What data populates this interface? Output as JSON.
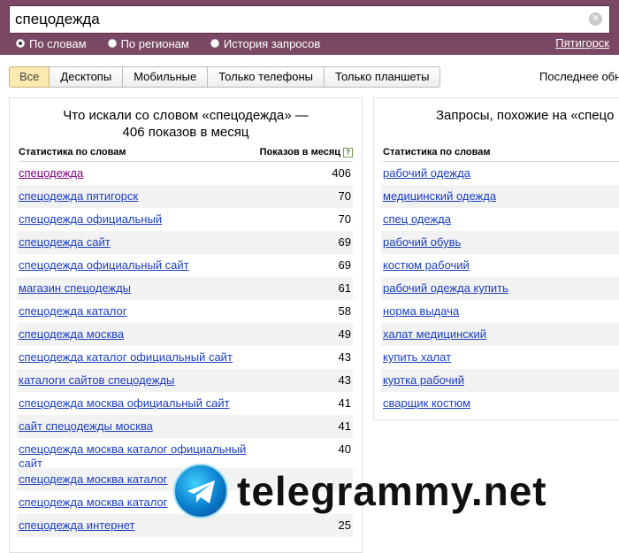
{
  "search": {
    "query": "спецодежда"
  },
  "modes": [
    {
      "label": "По словам",
      "selected": true
    },
    {
      "label": "По регионам",
      "selected": false
    },
    {
      "label": "История запросов",
      "selected": false
    }
  ],
  "region": "Пятигорск",
  "tabs": [
    "Все",
    "Десктопы",
    "Мобильные",
    "Только телефоны",
    "Только планшеты"
  ],
  "active_tab": "Все",
  "last_updated": "Последнее обн",
  "left_panel": {
    "title": "Что искали со словом «спецодежда» — 406 показов в месяц",
    "col_words": "Статистика по словам",
    "col_shows": "Показов в месяц",
    "help_icon": "?",
    "rows": [
      {
        "phrase": "спецодежда",
        "count": "406"
      },
      {
        "phrase": "спецодежда пятигорск",
        "count": "70"
      },
      {
        "phrase": "спецодежда официальный",
        "count": "70"
      },
      {
        "phrase": "спецодежда сайт",
        "count": "69"
      },
      {
        "phrase": "спецодежда официальный сайт",
        "count": "69"
      },
      {
        "phrase": "магазин спецодежды",
        "count": "61"
      },
      {
        "phrase": "спецодежда каталог",
        "count": "58"
      },
      {
        "phrase": "спецодежда москва",
        "count": "49"
      },
      {
        "phrase": "спецодежда каталог официальный сайт",
        "count": "43"
      },
      {
        "phrase": "каталоги сайтов спецодежды",
        "count": "43"
      },
      {
        "phrase": "спецодежда москва официальный сайт",
        "count": "41"
      },
      {
        "phrase": "сайт спецодежды москва",
        "count": "41"
      },
      {
        "phrase": "спецодежда москва каталог официальный сайт",
        "count": "40"
      },
      {
        "phrase": "спецодежда москва каталог",
        "count": ""
      },
      {
        "phrase": "спецодежда москва каталог",
        "count": ""
      },
      {
        "phrase": "спецодежда интернет",
        "count": "25"
      }
    ]
  },
  "right_panel": {
    "title": "Запросы, похожие на «спецо",
    "col_words": "Статистика по словам",
    "rows": [
      "рабочий одежда",
      "медицинский одежда",
      "спец одежда",
      "рабочий обувь",
      "костюм рабочий",
      "рабочий одежда купить",
      "норма выдача",
      "халат медицинский",
      "купить халат",
      "куртка рабочий",
      "сварщик костюм"
    ]
  },
  "watermark": {
    "text": "telegrammy.net",
    "icon": "telegram-icon"
  }
}
